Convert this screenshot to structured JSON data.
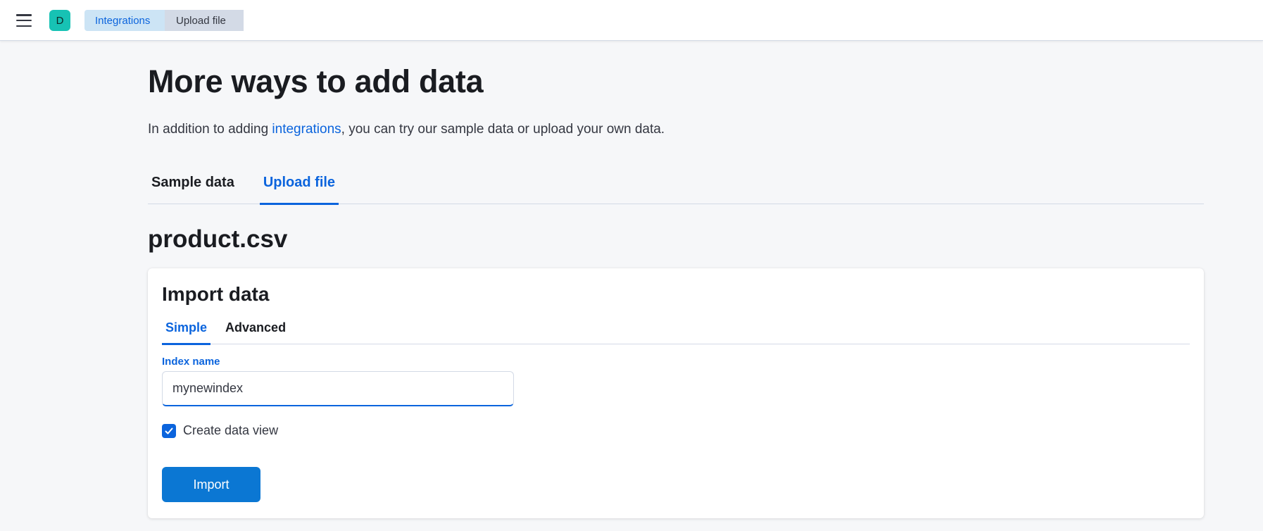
{
  "header": {
    "space_initial": "D",
    "breadcrumbs": [
      {
        "label": "Integrations"
      },
      {
        "label": "Upload file"
      }
    ]
  },
  "main": {
    "title": "More ways to add data",
    "intro": {
      "before": "In addition to adding ",
      "link": "integrations",
      "after": ", you can try our sample data or upload your own data."
    },
    "tabs": [
      {
        "label": "Sample data",
        "active": false
      },
      {
        "label": "Upload file",
        "active": true
      }
    ],
    "file_name": "product.csv"
  },
  "import_panel": {
    "title": "Import data",
    "tabs": [
      {
        "label": "Simple",
        "active": true
      },
      {
        "label": "Advanced",
        "active": false
      }
    ],
    "index_name_label": "Index name",
    "index_name_value": "mynewindex",
    "create_data_view_label": "Create data view",
    "create_data_view_checked": true,
    "import_button_label": "Import"
  },
  "colors": {
    "accent": "#0b64dd",
    "button": "#0b77d3",
    "avatar": "#17c2b4",
    "background": "#f6f7f9"
  }
}
